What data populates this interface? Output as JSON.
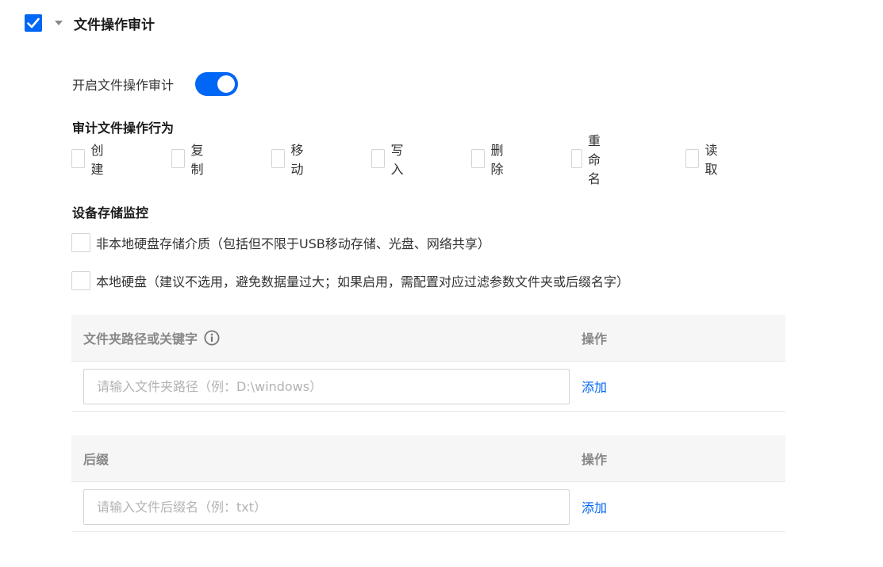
{
  "section": {
    "title": "文件操作审计",
    "enabled_checked": true,
    "expanded": true
  },
  "toggle": {
    "label": "开启文件操作审计",
    "on": true
  },
  "audit_actions": {
    "title": "审计文件操作行为",
    "items": [
      {
        "label": "创建",
        "checked": false
      },
      {
        "label": "复制",
        "checked": false
      },
      {
        "label": "移动",
        "checked": false
      },
      {
        "label": "写入",
        "checked": false
      },
      {
        "label": "删除",
        "checked": false
      },
      {
        "label": "重命名",
        "checked": false
      },
      {
        "label": "读取",
        "checked": false
      }
    ]
  },
  "storage": {
    "title": "设备存储监控",
    "items": [
      {
        "label": "非本地硬盘存储介质（包括但不限于USB移动存储、光盘、网络共享）",
        "checked": false
      },
      {
        "label": "本地硬盘（建议不选用，避免数据量过大；如果启用，需配置对应过滤参数文件夹或后缀名字）",
        "checked": false
      }
    ]
  },
  "folder_table": {
    "col_path": "文件夹路径或关键字",
    "col_action": "操作",
    "input_value": "",
    "input_placeholder": "请输入文件夹路径（例：D:\\windows）",
    "add_label": "添加"
  },
  "suffix_table": {
    "col_suffix": "后缀",
    "col_action": "操作",
    "input_value": "",
    "input_placeholder": "请输入文件后缀名（例：txt）",
    "add_label": "添加"
  },
  "colors": {
    "primary": "#0066f5",
    "header_bg": "#f6f6f6",
    "border": "#d4d4d4"
  },
  "icons": [
    "checkmark-icon",
    "caret-down-icon",
    "info-icon"
  ]
}
